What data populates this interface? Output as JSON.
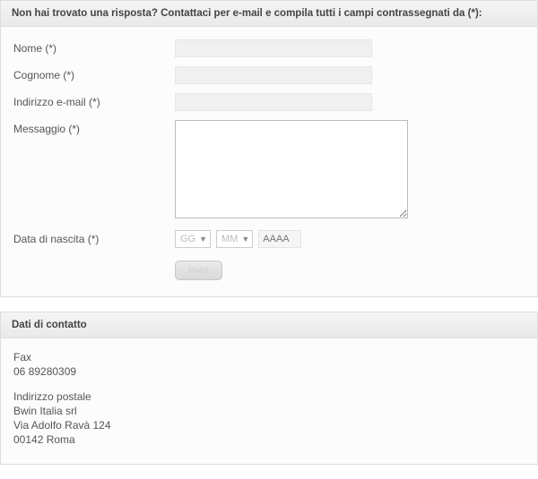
{
  "form": {
    "header": "Non hai trovato una risposta? Contattaci per e-mail e compila tutti i campi contrassegnati da (*):",
    "fields": {
      "nome_label": "Nome (*)",
      "cognome_label": "Cognome (*)",
      "email_label": "Indirizzo e-mail (*)",
      "messaggio_label": "Messaggio (*)",
      "dob_label": "Data di nascita (*)"
    },
    "dob": {
      "day_placeholder": "GG",
      "month_placeholder": "MM",
      "year_placeholder": "AAAA"
    },
    "submit_label": "Invia"
  },
  "contact": {
    "header": "Dati di contatto",
    "fax_label": "Fax",
    "fax_number": "06 89280309",
    "postal_label": "Indirizzo postale",
    "company": "Bwin Italia srl",
    "street": "Via Adolfo Ravà 124",
    "city": "00142 Roma"
  }
}
